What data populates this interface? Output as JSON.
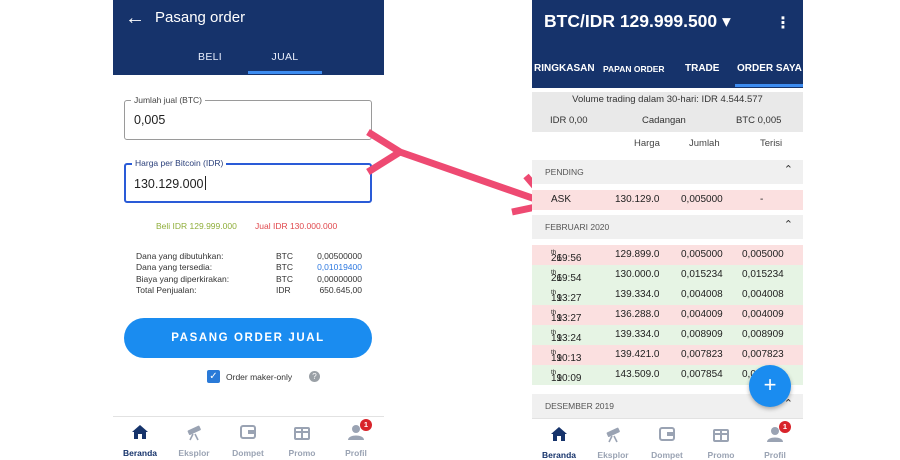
{
  "left": {
    "header_title": "Pasang order",
    "tabs": [
      {
        "label": "BELI"
      },
      {
        "label": "JUAL"
      }
    ],
    "amount_field": {
      "label": "Jumlah jual (BTC)",
      "value": "0,005"
    },
    "price_field": {
      "label": "Harga per Bitcoin (IDR)",
      "value": "130.129.000"
    },
    "buy_price": "Beli IDR 129.999.000",
    "sell_price": "Jual IDR 130.000.000",
    "summary": [
      {
        "label": "Dana yang dibutuhkan:",
        "currency": "BTC",
        "amount": "0,00500000"
      },
      {
        "label": "Dana yang tersedia:",
        "currency": "BTC",
        "amount": "0,01019400"
      },
      {
        "label": "Biaya yang diperkirakan:",
        "currency": "BTC",
        "amount": "0,00000000"
      },
      {
        "label": "Total Penjualan:",
        "currency": "IDR",
        "amount": "650.645,00"
      }
    ],
    "submit_label": "PASANG ORDER JUAL",
    "maker_only": {
      "label": "Order maker-only",
      "checked": true,
      "help": "?"
    }
  },
  "right": {
    "pair_title": "BTC/IDR 129.999.500 ▾",
    "menu": "⋮",
    "tabs": [
      {
        "label": "RINGKASAN"
      },
      {
        "label": "PAPAN ORDER"
      },
      {
        "label": "TRADE"
      },
      {
        "label": "ORDER SAYA"
      }
    ],
    "volume_text": "Volume trading dalam 30-hari: IDR 4.544.577",
    "balance_idr": "IDR 0,00",
    "reserve_label": "Cadangan",
    "balance_btc": "BTC 0,005",
    "columns": {
      "price": "Harga",
      "amount": "Jumlah",
      "filled": "Terisi"
    },
    "pending_section": "PENDING",
    "pending_order": {
      "type": "ASK",
      "price": "130.129.0",
      "amount": "0,005000",
      "filled": "-"
    },
    "feb_section": "FEBRUARI 2020",
    "history": [
      {
        "day": "26",
        "sfx": "th",
        "time": " 19:56",
        "price": "129.899.0",
        "amount": "0,005000",
        "filled": "0,005000",
        "side": "sell"
      },
      {
        "day": "26",
        "sfx": "th",
        "time": " 19:54",
        "price": "130.000.0",
        "amount": "0,015234",
        "filled": "0,015234",
        "side": "buy"
      },
      {
        "day": "19",
        "sfx": "th",
        "time": " 13:27",
        "price": "139.334.0",
        "amount": "0,004008",
        "filled": "0,004008",
        "side": "buy"
      },
      {
        "day": "19",
        "sfx": "th",
        "time": " 13:27",
        "price": "136.288.0",
        "amount": "0,004009",
        "filled": "0,004009",
        "side": "sell"
      },
      {
        "day": "19",
        "sfx": "th",
        "time": " 13:24",
        "price": "139.334.0",
        "amount": "0,008909",
        "filled": "0,008909",
        "side": "buy"
      },
      {
        "day": "19",
        "sfx": "th",
        "time": " 10:13",
        "price": "139.421.0",
        "amount": "0,007823",
        "filled": "0,007823",
        "side": "sell"
      },
      {
        "day": "19",
        "sfx": "th",
        "time": " 10:09",
        "price": "143.509.0",
        "amount": "0,007854",
        "filled": "0,00",
        "side": "buy"
      }
    ],
    "dec_section": "DESEMBER 2019",
    "fab": "+"
  },
  "nav": {
    "items": [
      {
        "label": "Beranda",
        "icon": "home-icon"
      },
      {
        "label": "Eksplor",
        "icon": "telescope-icon"
      },
      {
        "label": "Dompet",
        "icon": "wallet-icon"
      },
      {
        "label": "Promo",
        "icon": "gift-icon"
      },
      {
        "label": "Profil",
        "icon": "user-icon"
      }
    ],
    "badge": "1"
  },
  "colors": {
    "header": "#16336b",
    "accent": "#1a8cf0",
    "sell": "#e0484d",
    "buy": "#8fae3a",
    "arrow": "#ee4a72"
  }
}
